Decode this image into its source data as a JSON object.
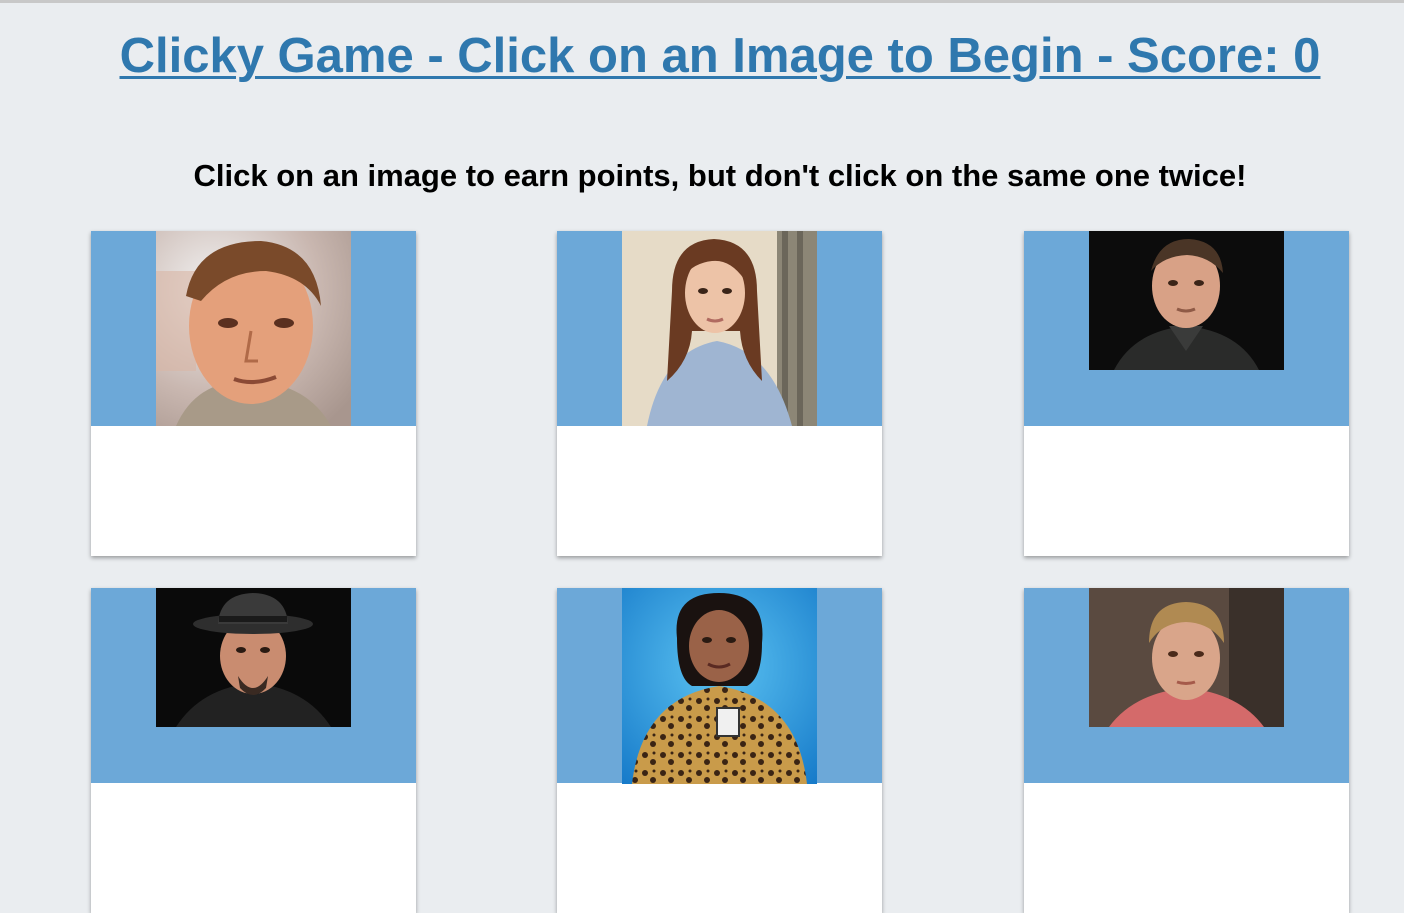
{
  "header": {
    "title": "Clicky Game - Click on an Image to Begin - Score: 0"
  },
  "instructions": "Click on an image to earn points, but don't click on the same one twice!",
  "cards": [
    {
      "name": "card-1",
      "photo_desc": "man-portrait-icon"
    },
    {
      "name": "card-2",
      "photo_desc": "woman-long-hair-icon"
    },
    {
      "name": "card-3",
      "photo_desc": "man-dark-background-icon"
    },
    {
      "name": "card-4",
      "photo_desc": "man-hat-icon"
    },
    {
      "name": "card-5",
      "photo_desc": "woman-leopard-top-icon"
    },
    {
      "name": "card-6",
      "photo_desc": "woman-portrait-icon"
    }
  ],
  "colors": {
    "background": "#eaedf0",
    "title": "#2f78ae",
    "card_top": "#6ca8d8",
    "card_bottom": "#ffffff"
  }
}
